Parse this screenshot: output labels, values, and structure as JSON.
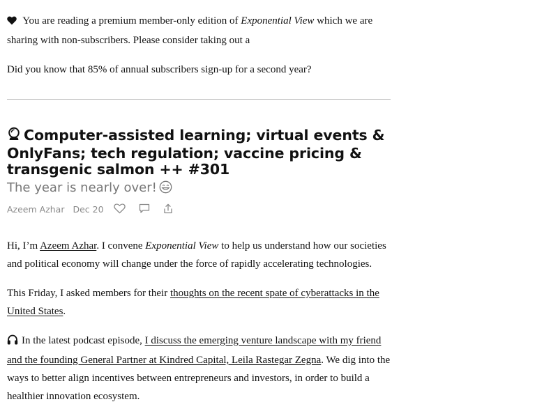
{
  "notice": {
    "intro_text": " You are reading a premium member-only edition of ",
    "publication_name": "Exponential View",
    "outro_text": " which we are sharing with non-subscribers. Please consider taking out a"
  },
  "renewal_note": "Did you know that 85% of annual subscribers sign-up for a second year?",
  "post": {
    "title": "Computer-assisted learning; virtual events & OnlyFans; tech regulation; vaccine pricing & transgenic salmon ++ #301",
    "subtitle": "The year is nearly over!",
    "author": "Azeem Azhar",
    "date": "Dec 20"
  },
  "paragraph_intro": {
    "before_link": "Hi, I’m ",
    "author_link": "Azeem Azhar",
    "middle": ". I convene ",
    "publication_name": "Exponential View",
    "after": " to help us understand how our societies and political economy will change under the force of rapidly accelerating technologies."
  },
  "paragraph_friday": {
    "before_link": "This Friday, I asked members for their ",
    "link_text": "thoughts on the recent spate of cyberattacks in the United States",
    "after": "."
  },
  "paragraph_podcast": {
    "before_link": "In the latest podcast episode, ",
    "link_text": "I discuss the emerging venture landscape with my friend and the founding General Partner at Kindred Capital, Leila Rastegar Zegna",
    "after": ". We dig into the ways to better align incentives between entrepreneurs and investors, in order to build a healthier innovation ecosystem."
  },
  "icons": {
    "notice": "heart-icon",
    "title": "crystal-ball-icon",
    "subtitle": "smile-emoji-icon",
    "like": "heart-outline-icon",
    "comment": "comment-icon",
    "share": "share-icon",
    "podcast": "headphones-icon"
  },
  "colors": {
    "text": "#111111",
    "subtitle": "#777777",
    "meta": "#8a8a8a",
    "divider": "#bcbcbc"
  }
}
